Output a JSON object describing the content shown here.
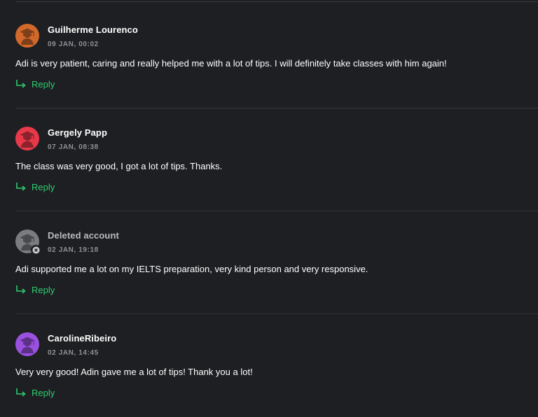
{
  "colors": {
    "background": "#1e1f22",
    "accent_green": "#2ecc71",
    "divider": "#34363a"
  },
  "comments": [
    {
      "author": "Guilherme Lourenco",
      "timestamp": "09 JAN, 00:02",
      "text": "Adi is very patient, caring and really helped me with a lot of tips. I will definitely take classes with him again!",
      "reply_label": "Reply",
      "avatar_color": "#d2692b",
      "avatar_icon": "graduation-cap-icon",
      "deleted": false
    },
    {
      "author": "Gergely Papp",
      "timestamp": "07 JAN, 08:38",
      "text": "The class was very good, I got a lot of tips. Thanks.",
      "reply_label": "Reply",
      "avatar_color": "#e8394a",
      "avatar_icon": "graduation-cap-icon",
      "deleted": false
    },
    {
      "author": "Deleted account",
      "timestamp": "02 JAN, 19:18",
      "text": "Adi supported me a lot on my IELTS preparation, very kind person and very responsive.",
      "reply_label": "Reply",
      "avatar_color": "#7a7c80",
      "avatar_icon": "graduation-cap-icon",
      "deleted": true
    },
    {
      "author": "CarolineRibeiro",
      "timestamp": "02 JAN, 14:45",
      "text": "Very very good! Adin gave me a lot of tips! Thank you a lot!",
      "reply_label": "Reply",
      "avatar_color": "#9b51e0",
      "avatar_icon": "graduation-cap-icon",
      "deleted": false
    }
  ]
}
